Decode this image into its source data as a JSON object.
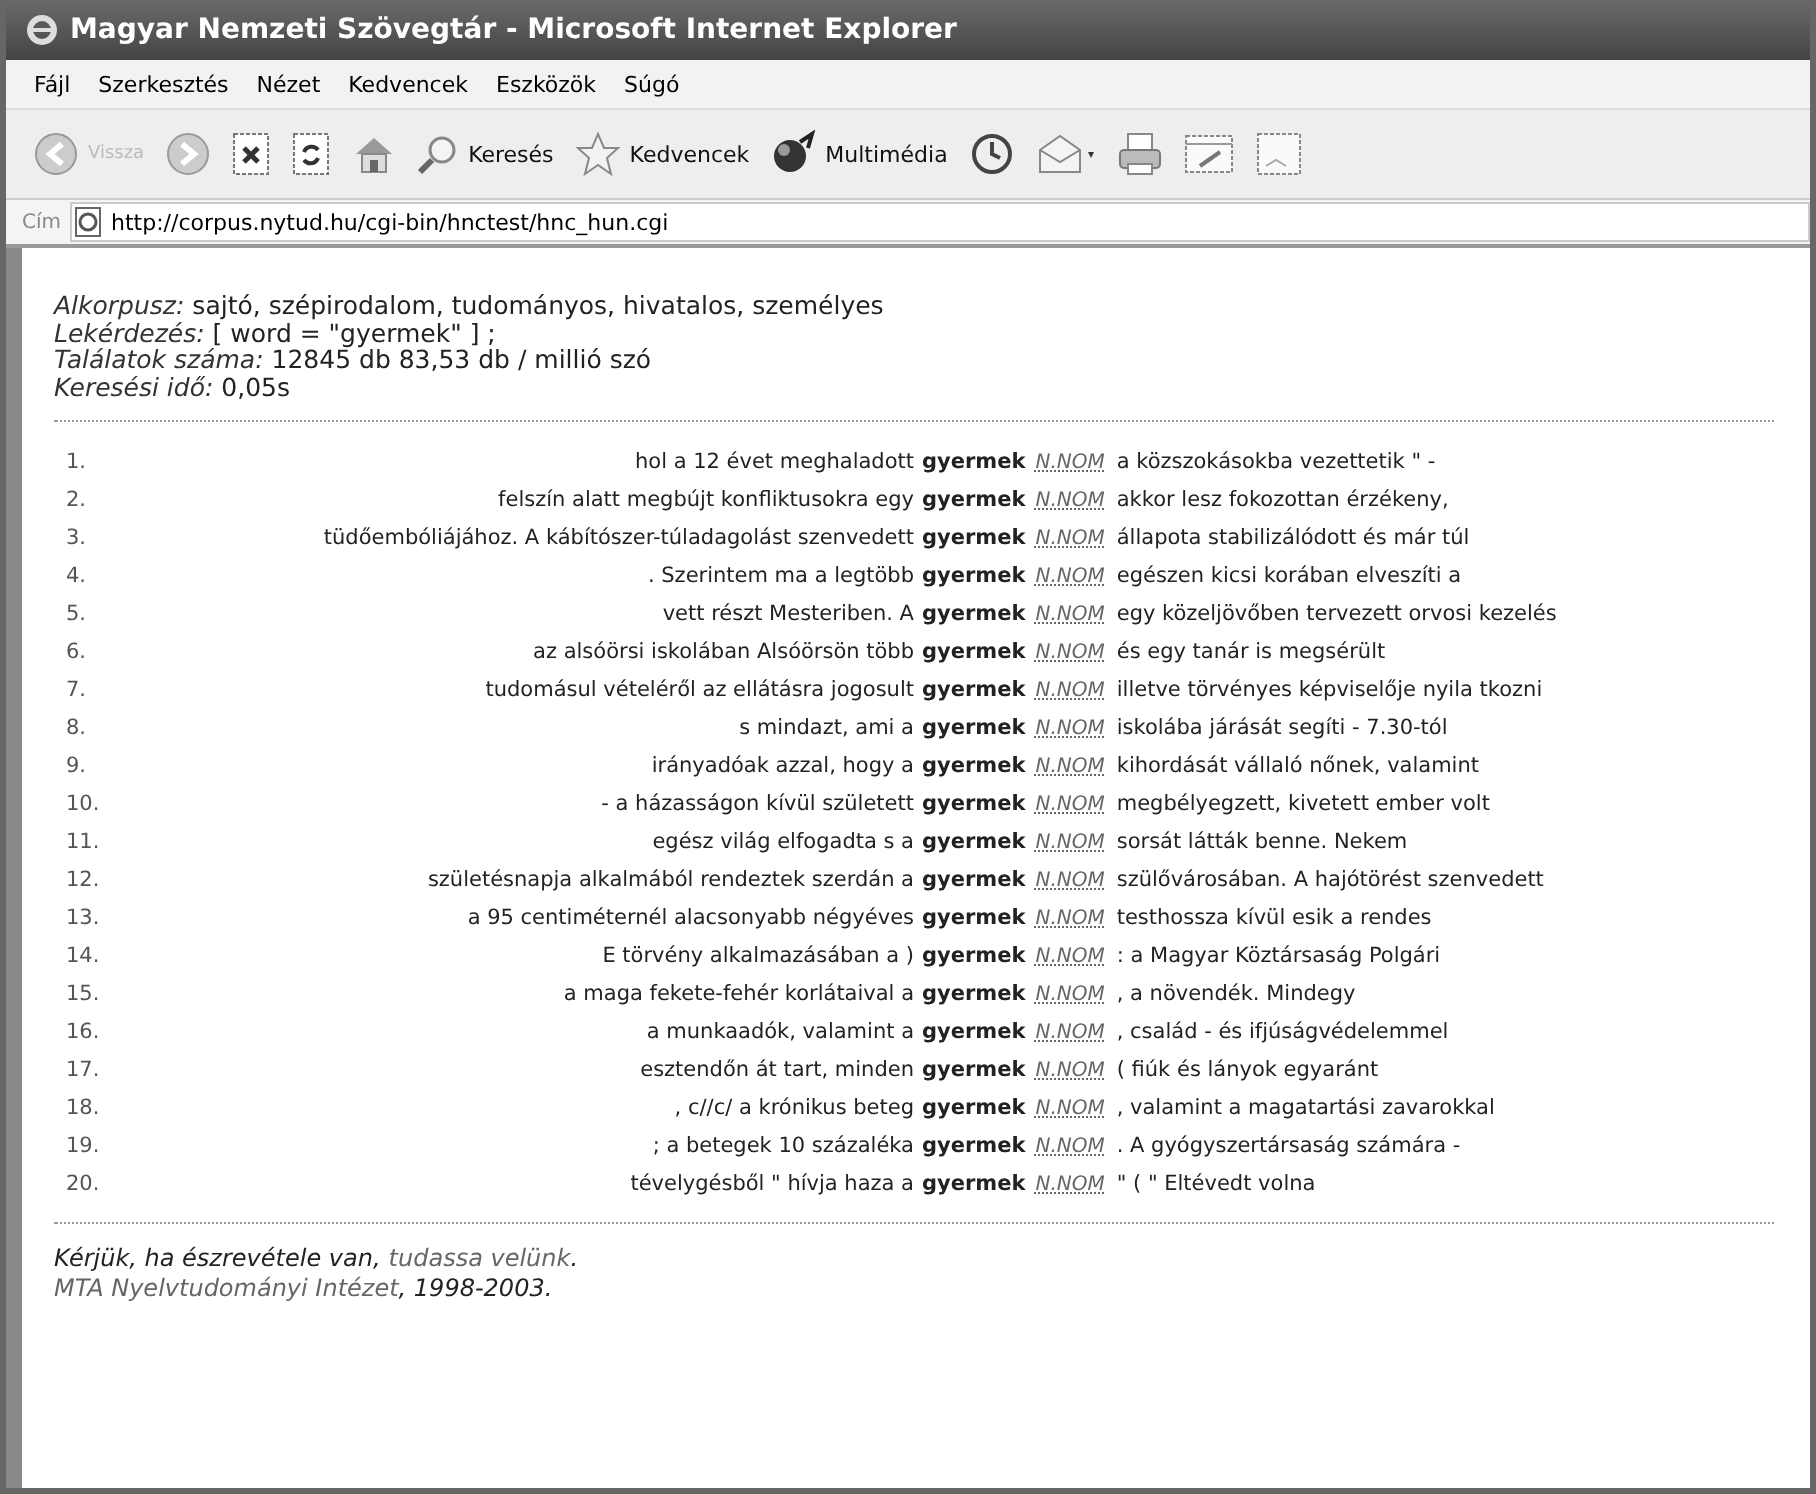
{
  "window": {
    "title": "Magyar Nemzeti Szövegtár - Microsoft Internet Explorer"
  },
  "menu": [
    "Fájl",
    "Szerkesztés",
    "Nézet",
    "Kedvencek",
    "Eszközök",
    "Súgó"
  ],
  "toolbar": [
    {
      "kind": "back",
      "label": "Vissza",
      "disabled": true
    },
    {
      "kind": "forward",
      "disabled": true
    },
    {
      "kind": "stop",
      "disabled": false
    },
    {
      "kind": "refresh",
      "disabled": false
    },
    {
      "kind": "home",
      "disabled": false
    },
    {
      "kind": "search",
      "label": "Keresés",
      "disabled": false
    },
    {
      "kind": "favorites",
      "label": "Kedvencek",
      "disabled": false
    },
    {
      "kind": "media",
      "label": "Multimédia",
      "disabled": false
    },
    {
      "kind": "history",
      "disabled": false
    },
    {
      "kind": "mail",
      "disabled": false
    },
    {
      "kind": "print",
      "disabled": false
    },
    {
      "kind": "edit",
      "disabled": false
    },
    {
      "kind": "discuss",
      "disabled": false
    }
  ],
  "address": {
    "label": "Cím",
    "url": "http://corpus.nytud.hu/cgi-bin/hnctest/hnc_hun.cgi"
  },
  "query_info": [
    {
      "label": "Alkorpusz:",
      "value": "sajtó, szépirodalom, tudományos, hivatalos, személyes"
    },
    {
      "label": "Lekérdezés:",
      "value": "[ word = \"gyermek\" ] ;"
    },
    {
      "label": "Találatok száma:",
      "value": " 12845 db  83,53 db / millió szó"
    },
    {
      "label": "Keresési idő:",
      "value": " 0,05s"
    }
  ],
  "rows": [
    {
      "num": "1.",
      "left": "hol a 12 évet meghaladott",
      "keyword": "gyermek",
      "tag": "N.NOM",
      "right": "a közszokásokba vezettetik \" -"
    },
    {
      "num": "2.",
      "left": "felszín alatt megbújt konfliktusokra egy",
      "keyword": "gyermek",
      "tag": "N.NOM",
      "right": "akkor lesz fokozottan érzékeny,"
    },
    {
      "num": "3.",
      "left": "tüdőembóliájához. A kábítószer-túladagolást szenvedett",
      "keyword": "gyermek",
      "tag": "N.NOM",
      "right": "állapota stabilizálódott és már túl"
    },
    {
      "num": "4.",
      "left": ". Szerintem ma a legtöbb",
      "keyword": "gyermek",
      "tag": "N.NOM",
      "right": "egészen kicsi korában elveszíti a"
    },
    {
      "num": "5.",
      "left": "vett részt Mesteriben. A",
      "keyword": "gyermek",
      "tag": "N.NOM",
      "right": "egy közeljövőben tervezett orvosi kezelés"
    },
    {
      "num": "6.",
      "left": "az alsóörsi iskolában Alsóörsön több",
      "keyword": "gyermek",
      "tag": "N.NOM",
      "right": "és egy tanár is megsérült"
    },
    {
      "num": "7.",
      "left": "tudomásul vételéről az ellátásra jogosult",
      "keyword": "gyermek",
      "tag": "N.NOM",
      "right": "illetve törvényes képviselője nyila tkozni"
    },
    {
      "num": "8.",
      "left": "s mindazt, ami a",
      "keyword": "gyermek",
      "tag": "N.NOM",
      "right": "iskolába járását segíti - 7.30-tól"
    },
    {
      "num": "9.",
      "left": "irányadóak azzal, hogy a",
      "keyword": "gyermek",
      "tag": "N.NOM",
      "right": "kihordását vállaló nőnek, valamint"
    },
    {
      "num": "10.",
      "left": "- a házasságon kívül született",
      "keyword": "gyermek",
      "tag": "N.NOM",
      "right": "megbélyegzett, kivetett ember volt"
    },
    {
      "num": "11.",
      "left": "egész világ elfogadta s a",
      "keyword": "gyermek",
      "tag": "N.NOM",
      "right": "sorsát látták benne. Nekem"
    },
    {
      "num": "12.",
      "left": "születésnapja alkalmából rendeztek szerdán a",
      "keyword": "gyermek",
      "tag": "N.NOM",
      "right": "szülővárosában. A hajótörést szenvedett"
    },
    {
      "num": "13.",
      "left": "a 95 centiméternél alacsonyabb négyéves",
      "keyword": "gyermek",
      "tag": "N.NOM",
      "right": "testhossza kívül esik a rendes"
    },
    {
      "num": "14.",
      "left": "E törvény alkalmazásában a )",
      "keyword": "gyermek",
      "tag": "N.NOM",
      "right": ": a Magyar Köztársaság Polgári"
    },
    {
      "num": "15.",
      "left": "a maga fekete-fehér korlátaival a",
      "keyword": "gyermek",
      "tag": "N.NOM",
      "right": ", a növendék. Mindegy"
    },
    {
      "num": "16.",
      "left": "a munkaadók, valamint a",
      "keyword": "gyermek",
      "tag": "N.NOM",
      "right": ", család - és ifjúságvédelemmel"
    },
    {
      "num": "17.",
      "left": "esztendőn át tart, minden",
      "keyword": "gyermek",
      "tag": "N.NOM",
      "right": "( fiúk és lányok egyaránt"
    },
    {
      "num": "18.",
      "left": ", c//c/ a krónikus beteg",
      "keyword": "gyermek",
      "tag": "N.NOM",
      "right": ", valamint a magatartási zavarokkal"
    },
    {
      "num": "19.",
      "left": "; a betegek 10 százaléka",
      "keyword": "gyermek",
      "tag": "N.NOM",
      "right": ". A gyógyszertársaság számára -"
    },
    {
      "num": "20.",
      "left": "tévelygésből \" hívja haza a",
      "keyword": "gyermek",
      "tag": "N.NOM",
      "right": "\" ( \" Eltévedt volna"
    }
  ],
  "footer": [
    {
      "text": "Kérjük, ha észrevétele van,",
      "link": "tudassa velünk",
      "after": "."
    },
    {
      "link": "MTA Nyelvtudományi Intézet",
      "text": ", 1998-2003."
    }
  ]
}
